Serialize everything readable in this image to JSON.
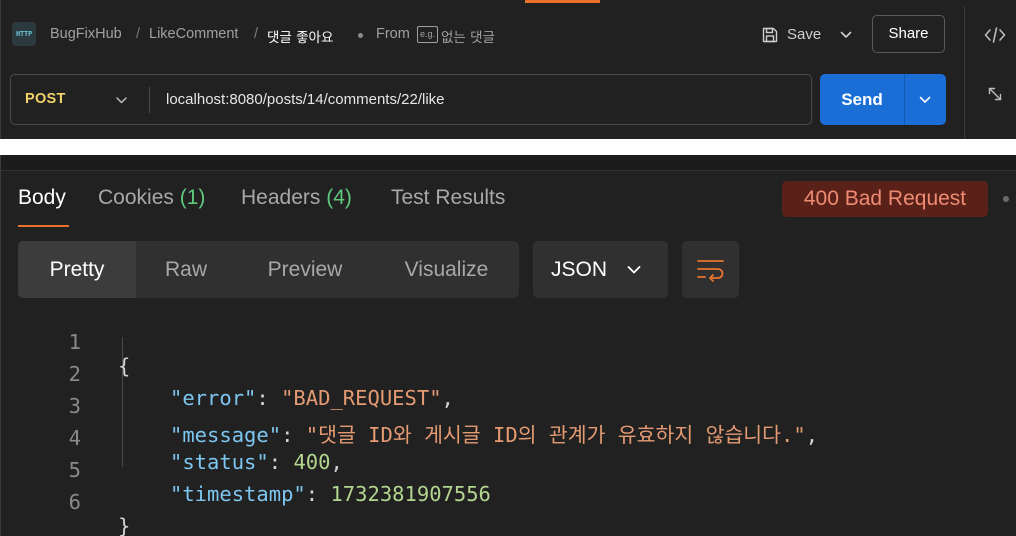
{
  "header": {
    "http_icon": "HTTP",
    "breadcrumb": [
      "BugFixHub",
      "LikeComment"
    ],
    "breadcrumb_sep": "/",
    "current": "댓글 좋아요",
    "from_label": "From",
    "from_badge": "e.g.",
    "from_name": "없는 댓글",
    "save_label": "Save",
    "share_label": "Share"
  },
  "request": {
    "method": "POST",
    "url": "localhost:8080/posts/14/comments/22/like",
    "send_label": "Send"
  },
  "response": {
    "tabs": [
      {
        "label": "Body",
        "count": ""
      },
      {
        "label": "Cookies",
        "count": "(1)"
      },
      {
        "label": "Headers",
        "count": "(4)"
      },
      {
        "label": "Test Results",
        "count": ""
      }
    ],
    "status": "400 Bad Request",
    "view_modes": [
      "Pretty",
      "Raw",
      "Preview",
      "Visualize"
    ],
    "format": "JSON",
    "code": {
      "line_numbers": [
        "1",
        "2",
        "3",
        "4",
        "5",
        "6"
      ],
      "open_brace": "{",
      "close_brace": "}",
      "fields": [
        {
          "key": "\"error\"",
          "value": "\"BAD_REQUEST\"",
          "suffix": ","
        },
        {
          "key": "\"message\"",
          "value": "\"댓글 ID와 게시글 ID의 관계가 유효하지 않습니다.\"",
          "suffix": ","
        },
        {
          "key": "\"status\"",
          "value": "400",
          "suffix": ","
        },
        {
          "key": "\"timestamp\"",
          "value": "1732381907556",
          "suffix": ""
        }
      ]
    }
  },
  "colors": {
    "accent": "#e8722c",
    "method": "#f3d368",
    "send": "#1a6ed6",
    "status_bg": "#5a2119",
    "status_text": "#ef8a73",
    "count": "#5fc97e",
    "json_key": "#7cc6f0",
    "json_string": "#e49a72",
    "json_number": "#b3d58f"
  },
  "icons": [
    "http-icon",
    "save-icon",
    "chevron-down-icon",
    "code-icon",
    "expand-icon",
    "wrap-icon"
  ]
}
